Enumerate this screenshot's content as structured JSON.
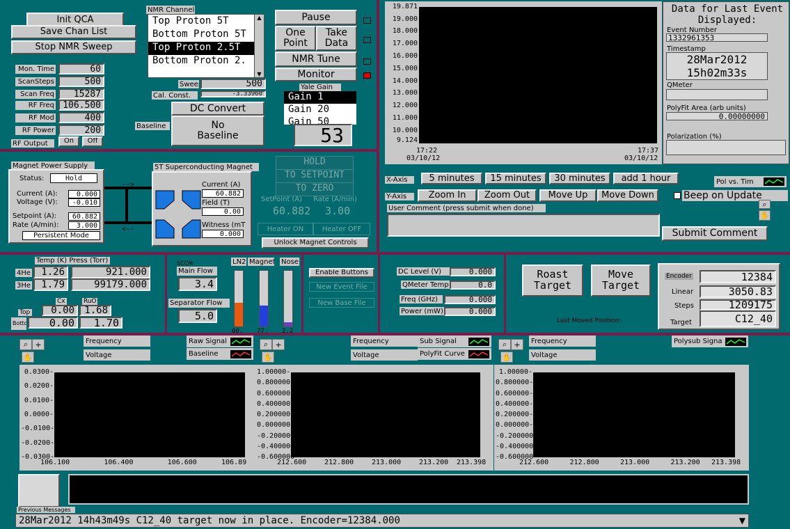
{
  "top_left": {
    "init_qca": "Init QCA",
    "save_chan_list": "Save Chan List",
    "stop_nmr_sweep": "Stop NMR Sweep"
  },
  "nmr": {
    "title": "NMR Channel",
    "channels": [
      "Top Proton 5T",
      "Bottom Proton 5T",
      "Top Proton 2.5T",
      "Bottom Proton 2."
    ],
    "sweeps_label": "Sweeps",
    "sweeps": "500",
    "cal_label": "Cal. Const.",
    "cal": "-3.33960"
  },
  "params": [
    {
      "label": "Mon. Time",
      "value": "60"
    },
    {
      "label": "ScanSteps",
      "value": "500"
    },
    {
      "label": "Scan Freq",
      "value": "15287"
    },
    {
      "label": "RF Freq",
      "value": "106.500"
    },
    {
      "label": "RF Mod",
      "value": "400"
    },
    {
      "label": "RF Power",
      "value": "200"
    }
  ],
  "rf_output": {
    "label": "RF Output",
    "on": "On",
    "off": "Off"
  },
  "controls": {
    "pause": "Pause",
    "one_point": "One Point",
    "take_data": "Take Data",
    "nmr_tune": "NMR Tune",
    "monitor": "Monitor",
    "dc_convert": "DC Convert",
    "baseline_label": "Baseline",
    "no_baseline": "No Baseline",
    "yale_gain": "Yale Gain",
    "gains": [
      "Gain 1",
      "Gain 20",
      "Gain 50"
    ],
    "big_value": "53"
  },
  "main_chart": {
    "yticks": [
      "19.871",
      "19.000",
      "18.000",
      "17.000",
      "16.000",
      "15.000",
      "14.000",
      "13.000",
      "12.000",
      "11.000",
      "10.000",
      "9.124"
    ],
    "x_left": "17:22",
    "x_left_date": "03/10/12",
    "x_right": "17:37",
    "x_right_date": "03/10/12",
    "pol_label": "Pol vs. Tim"
  },
  "axes": {
    "x_label": "X-Axis",
    "x_buttons": [
      "5 minutes",
      "15 minutes",
      "30 minutes",
      "add 1 hour"
    ],
    "y_label": "Y-Axis",
    "y_buttons": [
      "Zoom In",
      "Zoom Out",
      "Move Up",
      "Move Down"
    ],
    "beep": "Beep on Update"
  },
  "comment": {
    "label": "User Comment (press submit when done)",
    "submit": "Submit Comment"
  },
  "last_event": {
    "title": "Data for Last Event Displayed:",
    "event_label": "Event Number",
    "event": "1332961353",
    "ts_label": "Timestamp",
    "ts_date": "28Mar2012",
    "ts_time": "15h02m33s",
    "qmeter_label": "QMeter",
    "polyfit_label": "PolyFit Area (arb units)",
    "polyfit": "0.00000000",
    "pol_label": "Polarization (%)"
  },
  "magnet_ps": {
    "title": "Magnet Power Supply",
    "status_label": "Status:",
    "status": "Hold",
    "current_label": "Current  (A):",
    "current": "0.000",
    "voltage_label": "Voltage  (V):",
    "voltage": "-0.010",
    "setpoint_label": "Setpoint (A):",
    "setpoint": "60.882",
    "rate_label": "Rate (A/min):",
    "rate": "3.000",
    "persistent": "Persistent Mode"
  },
  "sc_magnet": {
    "title": "5T Superconducting Magnet",
    "current_label": "Current (A)",
    "current": "60.882",
    "field_label": "Field (T)",
    "field": "0.00",
    "witness_label": "Witness (mT",
    "witness": "0.000"
  },
  "magnet_ctl": {
    "hold": "HOLD",
    "to_setpoint": "TO SETPOINT",
    "to_zero": "TO ZERO",
    "sp_label": "SetPoint (A)",
    "rate_label": "Rate (A/min)",
    "sp": "60.882",
    "rate": "3.00",
    "heater_on": "Heater ON",
    "heater_off": "Heater OFF",
    "unlock": "Unlock Magnet Controls"
  },
  "temps": {
    "title": "Temp (K)  Press (Torr)",
    "he4_label": "4He",
    "he4_t": "1.26",
    "he4_p": "921.000",
    "he3_label": "3He",
    "he3_t": "1.79",
    "he3_p": "99179.000",
    "cx_label": "Cx",
    "ruo_label": "RuO",
    "top_label": "Top",
    "top_cx": "0.00",
    "top_ruo": "1.68",
    "bot_label": "Bottom",
    "bot_cx": "0.00",
    "bot_ruo": "1.70"
  },
  "flow": {
    "units": "SCCM",
    "main_label": "Main Flow",
    "main": "3.4",
    "sep_label": "Separator Flow",
    "sep": "5.0"
  },
  "levels": {
    "labels": [
      "LN2",
      "Magnet",
      "Nose"
    ],
    "values": [
      "60.",
      "77.",
      "2.2"
    ],
    "fills": [
      0.42,
      0.38,
      0.08
    ],
    "colors": [
      "#e85a10",
      "#2040e0",
      "#6a40c0"
    ]
  },
  "mid_buttons": {
    "enable": "Enable Buttons",
    "new_event": "New Event File",
    "new_base": "New Base File"
  },
  "qmeter": [
    {
      "label": "DC Level (V)",
      "value": "0.000"
    },
    {
      "label": "QMeter Temp",
      "value": "0.0"
    },
    {
      "label": "Freq (GHz)",
      "value": "0.000"
    },
    {
      "label": "Power (mW)",
      "value": "0.000"
    }
  ],
  "target": {
    "roast": "Roast Target",
    "move": "Move Target",
    "last_moved": "Last Moved Position:",
    "encoder_label": "Encoder",
    "encoder": "12384",
    "linear_label": "Linear",
    "linear": "3050.83",
    "steps_label": "Steps",
    "steps": "1209175",
    "target_label": "Target",
    "target": "C12_40"
  },
  "plots": [
    {
      "freq": "Frequency",
      "volt": "Voltage",
      "leg1": "Raw Signal",
      "leg2": "Baseline",
      "yticks": [
        "0.0300-",
        "0.0200-",
        "0.0100-",
        "0.0000-",
        "-0.0100-",
        "-0.0200-",
        "-0.0300-"
      ],
      "xticks": [
        "106.100",
        "106.400",
        "106.600",
        "106.89"
      ]
    },
    {
      "freq": "Frequency",
      "volt": "Voltage",
      "leg1": "Sub Signal",
      "leg2": "PolyFit Curve",
      "yticks": [
        "1.00000-",
        "0.800000-",
        "0.600000-",
        "0.400000-",
        "0.200000-",
        "0.000000-",
        "-0.200000-",
        "-0.400000-",
        "-0.600000-"
      ],
      "xticks": [
        "212.600",
        "212.800",
        "213.000",
        "213.200",
        "213.398"
      ]
    },
    {
      "freq": "Frequency",
      "volt": "Voltage",
      "leg1": "Polysub Signal",
      "yticks": [
        "1.00000-",
        "0.800000-",
        "0.600000-",
        "0.400000-",
        "0.200000-",
        "0.000000-",
        "-0.200000-",
        "-0.400000-",
        "-0.600000-"
      ],
      "xticks": [
        "212.600",
        "212.800",
        "213.000",
        "213.200",
        "213.398"
      ]
    }
  ],
  "messages": {
    "label": "Previous Messages",
    "last": "28Mar2012 14h43m49s C12_40 target now in place.  Encoder=12384.000"
  }
}
